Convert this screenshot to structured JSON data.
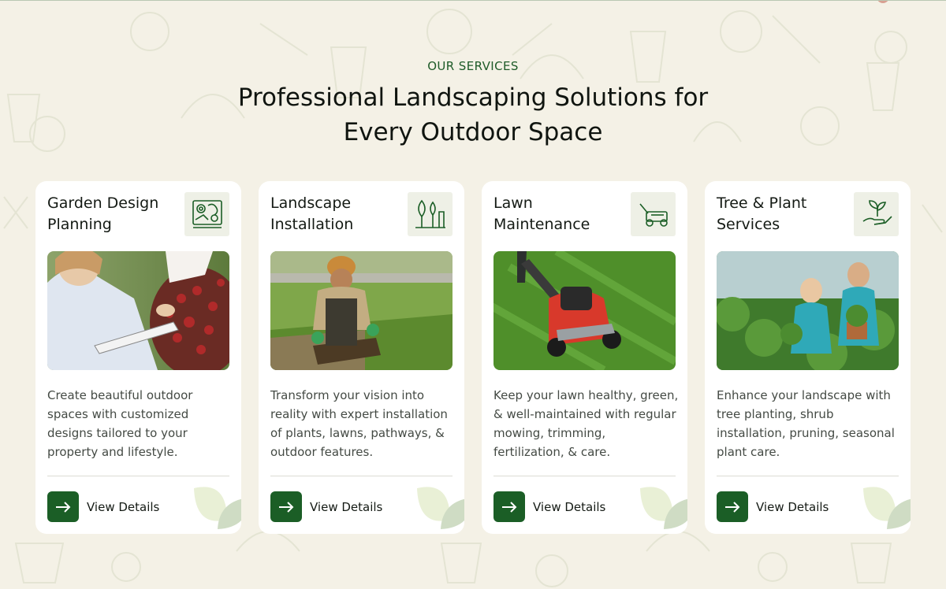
{
  "section": {
    "eyebrow": "OUR SERVICES",
    "headline_line1": "Professional Landscaping Solutions for",
    "headline_line2": "Every Outdoor Space"
  },
  "services": [
    {
      "title_line1": "Garden Design",
      "title_line2": "Planning",
      "icon": "garden-plan-icon",
      "image": "woman taking notes beside red flowers",
      "description": "Create beautiful outdoor spaces with customized designs tailored to your property and lifestyle.",
      "cta": "View Details"
    },
    {
      "title_line1": "Landscape",
      "title_line2": "Installation",
      "icon": "landscape-install-icon",
      "image": "worker laying sod rolls",
      "description": "Transform your vision into reality with expert installation of plants, lawns, pathways, & outdoor features.",
      "cta": "View Details"
    },
    {
      "title_line1": "Lawn",
      "title_line2": "Maintenance",
      "icon": "lawn-mower-icon",
      "image": "red lawn mower on grass",
      "description": "Keep your lawn healthy, green, & well-maintained with regular mowing, trimming, fertilization, & care.",
      "cta": "View Details"
    },
    {
      "title_line1": "Tree & Plant",
      "title_line2": "Services",
      "icon": "plant-hand-icon",
      "image": "two gardeners with potted plants",
      "description": "Enhance your landscape with tree planting, shrub installation, pruning, seasonal plant care.",
      "cta": "View Details"
    }
  ],
  "colors": {
    "background": "#f4f1e6",
    "accent": "#1b5e26",
    "card": "#ffffff"
  }
}
